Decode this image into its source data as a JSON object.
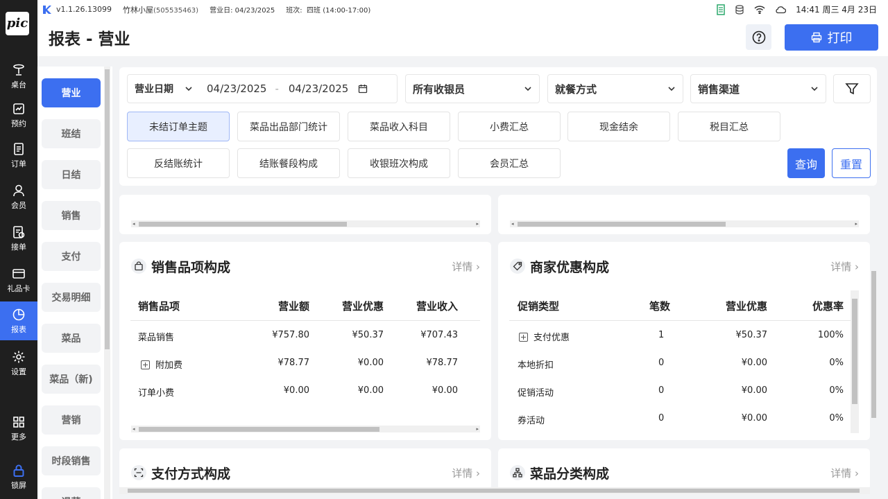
{
  "colors": {
    "accent": "#3c6ff0",
    "nav_bg": "#1f1f1f",
    "active_tag_bg": "#e8efff"
  },
  "statusbar": {
    "version": "v1.1.26.13099",
    "store": "竹林小屋",
    "store_id": "(505535463)",
    "business_day_label": "营业日:",
    "business_day": "04/23/2025",
    "shift_label": "班次:",
    "shift": "四班 (14:00-17:00)",
    "clock": "14:41 周三 4月 23日",
    "icons": [
      "barcode-icon",
      "database-icon",
      "wifi-icon",
      "cloud-icon"
    ]
  },
  "leftnav": {
    "brand": "pic",
    "items": [
      {
        "label": "桌台",
        "icon": "table-icon"
      },
      {
        "label": "预约",
        "icon": "reservation-icon"
      },
      {
        "label": "订单",
        "icon": "order-icon"
      },
      {
        "label": "会员",
        "icon": "member-icon"
      },
      {
        "label": "接单",
        "icon": "accept-order-icon"
      },
      {
        "label": "礼品卡",
        "icon": "gift-card-icon"
      },
      {
        "label": "报表",
        "icon": "report-icon",
        "active": true
      },
      {
        "label": "设置",
        "icon": "gear-icon"
      },
      {
        "label": "更多",
        "icon": "grid-icon"
      },
      {
        "label": "锁屏",
        "icon": "lock-icon"
      }
    ]
  },
  "header": {
    "title": "报表 - 营业",
    "print_label": "打印"
  },
  "subnav": {
    "items": [
      "营业",
      "班结",
      "日结",
      "销售",
      "支付",
      "交易明细",
      "菜品",
      "菜品（新)",
      "营销",
      "时段销售",
      "退菜"
    ],
    "active_index": 0
  },
  "filters": {
    "date_type": "营业日期",
    "date_from": "04/23/2025",
    "date_sep": "-",
    "date_to": "04/23/2025",
    "cashier": "所有收银员",
    "dining": "就餐方式",
    "channel": "销售渠道"
  },
  "tags": {
    "row1": [
      "未结订单主题",
      "菜品出品部门统计",
      "菜品收入科目",
      "小费汇总",
      "现金结余",
      "税目汇总"
    ],
    "row2": [
      "反结账统计",
      "结账餐段构成",
      "收银班次构成",
      "会员汇总"
    ],
    "active": "未结订单主题"
  },
  "buttons": {
    "query": "查询",
    "reset": "重置"
  },
  "detail_label": "详情 ›",
  "sales_items": {
    "title": "销售品项构成",
    "headers": [
      "销售品项",
      "营业额",
      "营业优惠",
      "营业收入"
    ],
    "rows": [
      {
        "name": "菜品销售",
        "expandable": false,
        "values": [
          "¥757.80",
          "¥50.37",
          "¥707.43"
        ]
      },
      {
        "name": "附加费",
        "expandable": true,
        "values": [
          "¥78.77",
          "¥0.00",
          "¥78.77"
        ]
      },
      {
        "name": "订单小费",
        "expandable": false,
        "values": [
          "¥0.00",
          "¥0.00",
          "¥0.00"
        ]
      }
    ]
  },
  "discounts": {
    "title": "商家优惠构成",
    "headers": [
      "促销类型",
      "笔数",
      "营业优惠",
      "优惠率"
    ],
    "rows": [
      {
        "name": "支付优惠",
        "expandable": true,
        "values": [
          "1",
          "¥50.37",
          "100%"
        ]
      },
      {
        "name": "本地折扣",
        "expandable": false,
        "values": [
          "0",
          "¥0.00",
          "0%"
        ]
      },
      {
        "name": "促销活动",
        "expandable": false,
        "values": [
          "0",
          "¥0.00",
          "0%"
        ]
      },
      {
        "name": "券活动",
        "expandable": false,
        "values": [
          "0",
          "¥0.00",
          "0%"
        ]
      }
    ]
  },
  "payment": {
    "title": "支付方式构成"
  },
  "category": {
    "title": "菜品分类构成"
  }
}
